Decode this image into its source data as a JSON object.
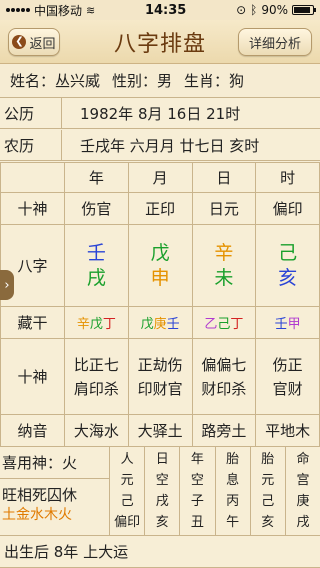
{
  "status": {
    "carrier": "中国移动",
    "time": "14:35",
    "battery": "90%",
    "battery_level": 0.9
  },
  "nav": {
    "back_label": "返回",
    "title": "八字排盘",
    "detail_label": "详细分析"
  },
  "person": {
    "name": "姓名：丛兴威",
    "gender": "性别：男",
    "zodiac": "生肖：狗"
  },
  "solar": {
    "label": "公历",
    "value": "1982年  8月 16日 21时"
  },
  "lunar": {
    "label": "农历",
    "value": "壬戌年 六月月 廿七日 亥时"
  },
  "pillars": {
    "headers": [
      "年",
      "月",
      "日",
      "时"
    ],
    "shishen_label": "十神",
    "shishen": [
      "伤官",
      "正印",
      "日元",
      "偏印"
    ],
    "bazi_label": "八字",
    "stems": [
      "壬",
      "戊",
      "辛",
      "己"
    ],
    "branches": [
      "戌",
      "申",
      "未",
      "亥"
    ],
    "canggan_label": "藏干",
    "canggan": [
      [
        "辛",
        "戊",
        "丁"
      ],
      [
        "戊",
        "庚",
        "壬"
      ],
      [
        "乙",
        "己",
        "丁"
      ],
      [
        "壬",
        "甲"
      ]
    ],
    "shishen2_label": "十神",
    "shishen2": [
      [
        "比正七",
        "肩印杀"
      ],
      [
        "正劫伤",
        "印财官"
      ],
      [
        "偏偏七",
        "财印杀"
      ],
      [
        "伤正",
        "官财"
      ]
    ],
    "nayin_label": "纳音",
    "nayin": [
      "大海水",
      "大驿土",
      "路旁土",
      "平地木"
    ]
  },
  "xiyong": "喜用神：火",
  "wangxiang_label": "旺相死囚休",
  "wangxiang_value": "土金水木火",
  "palaces": [
    [
      "人",
      "元",
      "己",
      "偏印"
    ],
    [
      "日",
      "空",
      "戌",
      "亥"
    ],
    [
      "年",
      "空",
      "子",
      "丑"
    ],
    [
      "胎",
      "息",
      "丙",
      "午"
    ],
    [
      "胎",
      "元",
      "己",
      "亥"
    ],
    [
      "命",
      "宫",
      "庚",
      "戌"
    ]
  ],
  "dayun": "出生后 8年 上大运",
  "colors": {
    "blue": "#2a44d6",
    "green": "#1aa02c",
    "orange": "#e59200",
    "purple": "#b03ad0",
    "red": "#d42222",
    "background": "#f7eed6",
    "title": "#6b3b10"
  }
}
